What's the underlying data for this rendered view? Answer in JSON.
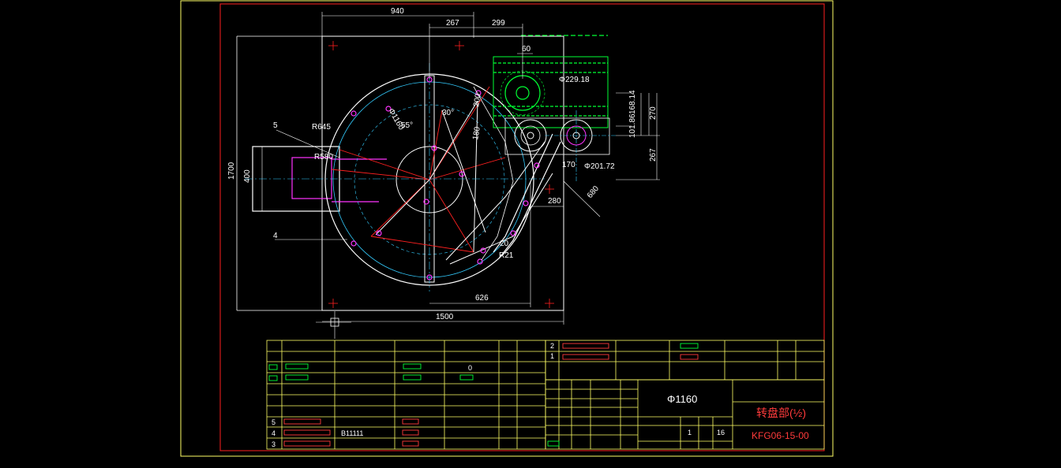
{
  "colors": {
    "background": "#000000",
    "border": "#ffff66",
    "frame": "#ff2020",
    "white": "#ffffff",
    "green": "#00ff33",
    "magenta": "#ff33ff",
    "cyan": "#33ccff",
    "red": "#ff2020",
    "yellow": "#ffff00"
  },
  "dimensions": {
    "d940": "940",
    "d267_top": "267",
    "d299": "299",
    "d60": "60",
    "d1700": "1700",
    "d400": "400",
    "d1500": "1500",
    "d626": "626",
    "d270": "270",
    "d267_right": "267",
    "d168_14": "168.14",
    "d101_86": "101.86",
    "d280": "280",
    "d680": "680",
    "d170": "170",
    "d229_18": "Φ229.18",
    "d201_72": "Φ201.72",
    "d1160_circ": "Φ1160",
    "d30deg": "30°",
    "d55deg": "55°",
    "r645": "R645",
    "r580": "R580",
    "r21": "R21",
    "d200": "200",
    "d180": "180",
    "d20": "20"
  },
  "labels": {
    "item5": "5",
    "item4": "4"
  },
  "title_block": {
    "diameter": "Φ1160",
    "drawing_title": "转盘部(½)",
    "drawing_number": "KFG06-15-00",
    "qty": "1",
    "sheet": "16",
    "rows_left": [
      "5",
      "4",
      "3"
    ],
    "rows_right": [
      "2",
      "1"
    ],
    "row4_text": "B11111",
    "row_right_0": "0"
  }
}
